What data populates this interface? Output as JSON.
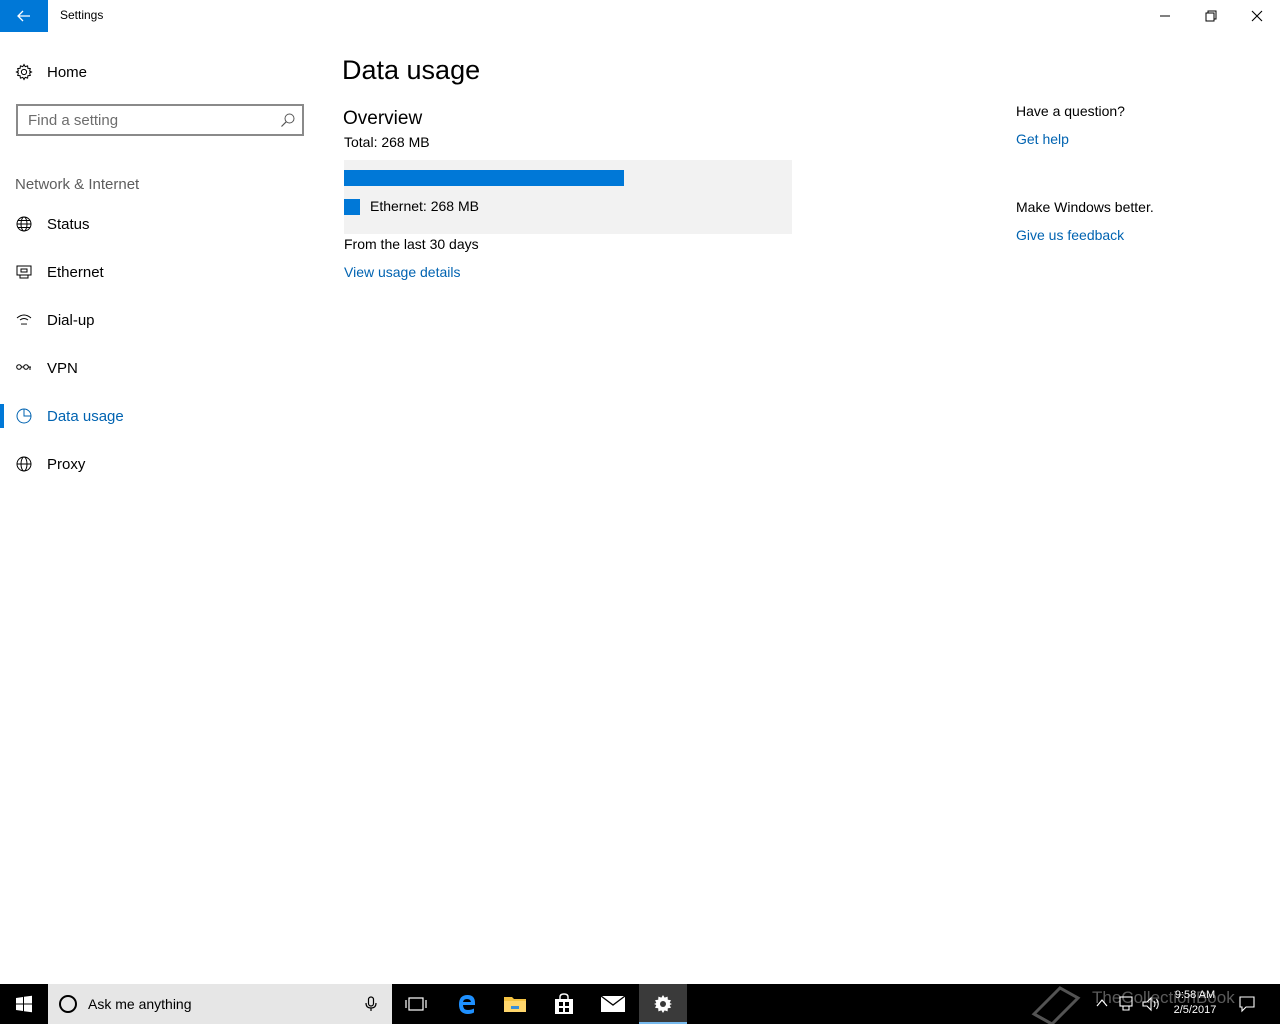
{
  "window": {
    "title": "Settings"
  },
  "sidebar": {
    "home_label": "Home",
    "search": {
      "placeholder": "Find a setting",
      "value": ""
    },
    "section_title": "Network & Internet",
    "items": [
      {
        "label": "Status",
        "icon": "globe-status-icon",
        "selected": false
      },
      {
        "label": "Ethernet",
        "icon": "ethernet-icon",
        "selected": false
      },
      {
        "label": "Dial-up",
        "icon": "dialup-icon",
        "selected": false
      },
      {
        "label": "VPN",
        "icon": "vpn-icon",
        "selected": false
      },
      {
        "label": "Data usage",
        "icon": "data-usage-icon",
        "selected": true
      },
      {
        "label": "Proxy",
        "icon": "globe-icon",
        "selected": false
      }
    ]
  },
  "main": {
    "page_title": "Data usage",
    "overview": {
      "title": "Overview",
      "total": "Total: 268 MB",
      "bar_fraction": 0.625,
      "legend": "Ethernet: 268 MB",
      "period": "From the last 30 days",
      "details_link": "View usage details"
    }
  },
  "right_column": {
    "question": "Have a question?",
    "help_link": "Get help",
    "feedback_prompt": "Make Windows better.",
    "feedback_link": "Give us feedback"
  },
  "taskbar": {
    "search_placeholder": "Ask me anything",
    "time": "9:58 AM",
    "date": "2/5/2017",
    "watermark": "TheCollectionBook"
  },
  "colors": {
    "accent": "#0078d7",
    "link": "#0063b1",
    "panel": "#f2f2f2",
    "taskbar": "#000000"
  }
}
